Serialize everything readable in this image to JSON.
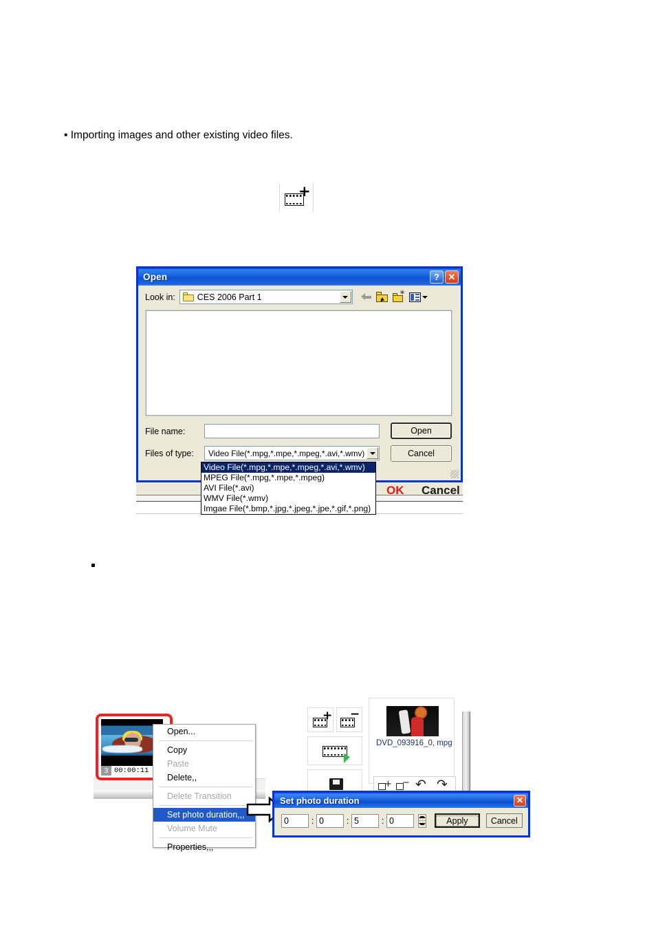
{
  "document": {
    "bullet_line_1": "• Importing images and other existing video files.",
    "bullet_line_2_marker": "•"
  },
  "toolbar_icon": {
    "name": "add-video-file-icon",
    "glyph": "+"
  },
  "open_dialog": {
    "title": "Open",
    "help_button": "?",
    "close_button": "✕",
    "look_in_label": "Look in:",
    "look_in_value": "CES 2006 Part 1",
    "file_name_label": "File name:",
    "file_name_value": "",
    "files_of_type_label": "Files of type:",
    "files_of_type_value": "Video File(*.mpg,*.mpe,*.mpeg,*.avi,*.wmv)",
    "open_button": "Open",
    "cancel_button": "Cancel",
    "filter_options": [
      "Video File(*.mpg,*.mpe,*.mpeg,*.avi,*.wmv)",
      "MPEG File(*.mpg,*.mpe,*.mpeg)",
      "AVI File(*.avi)",
      "WMV File(*.wmv)",
      "Imgae File(*.bmp,*.jpg,*.jpeg,*.jpe,*.gif,*.png)"
    ],
    "selected_filter_index": 0,
    "toolbar_icons": [
      "back-arrow-icon",
      "up-folder-icon",
      "new-folder-icon",
      "views-icon"
    ]
  },
  "behind_dialog": {
    "ok_label": "OK",
    "cancel_label": "Cancel",
    "ok_color": "#e01b1b",
    "cancel_color": "#1a1a1a"
  },
  "timeline": {
    "clip_number": "3",
    "clip_duration": "00:00:11"
  },
  "media_library": {
    "file_label": "DVD_093916_0, mpg"
  },
  "context_menu": {
    "items": [
      {
        "label": "Open...",
        "state": "normal"
      },
      {
        "label": "---",
        "state": "separator"
      },
      {
        "label": "Copy",
        "state": "normal"
      },
      {
        "label": "Paste",
        "state": "disabled"
      },
      {
        "label": "Delete,,",
        "state": "normal"
      },
      {
        "label": "---",
        "state": "separator"
      },
      {
        "label": "Delete Transition",
        "state": "disabled"
      },
      {
        "label": "---",
        "state": "separator"
      },
      {
        "label": "Set photo duration,,,",
        "state": "selected"
      },
      {
        "label": "Volume Mute",
        "state": "disabled"
      },
      {
        "label": "---",
        "state": "separator"
      },
      {
        "label": "Properties,,,",
        "state": "normal"
      }
    ]
  },
  "set_photo_duration": {
    "title": "Set photo duration",
    "close_button": "✕",
    "fields": [
      "0",
      "0",
      "5",
      "0"
    ],
    "separator": ":",
    "apply_button": "Apply",
    "cancel_button": "Cancel"
  },
  "colors": {
    "titlebar_blue": "#0a59d8",
    "dialog_face": "#ece9d8",
    "selection_blue": "#0a246a",
    "menu_highlight": "#2059c8",
    "thumb_border_red": "#f22121"
  }
}
